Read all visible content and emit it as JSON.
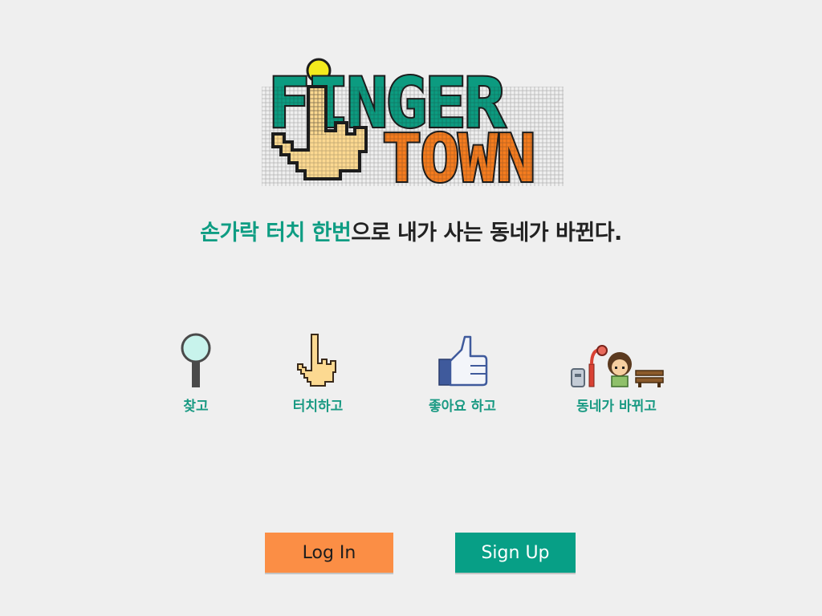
{
  "logo": {
    "line1": "FINGER",
    "line2": "TOWN"
  },
  "tagline": {
    "highlight": "손가락 터치 한번",
    "rest": "으로 내가 사는 동네가 바뀐다."
  },
  "features": [
    {
      "icon": "magnifier-icon",
      "label": "찾고"
    },
    {
      "icon": "pointing-hand-icon",
      "label": "터치하고"
    },
    {
      "icon": "thumbs-up-icon",
      "label": "좋아요 하고"
    },
    {
      "icon": "town-scene-icon",
      "label": "동네가 바뀌고"
    }
  ],
  "buttons": {
    "login": "Log In",
    "signup": "Sign Up"
  },
  "colors": {
    "background": "#efefef",
    "accent_teal": "#0f9d83",
    "login_orange": "#fb8e45",
    "signup_teal": "#079f86",
    "logo_orange": "#f57c1f"
  }
}
